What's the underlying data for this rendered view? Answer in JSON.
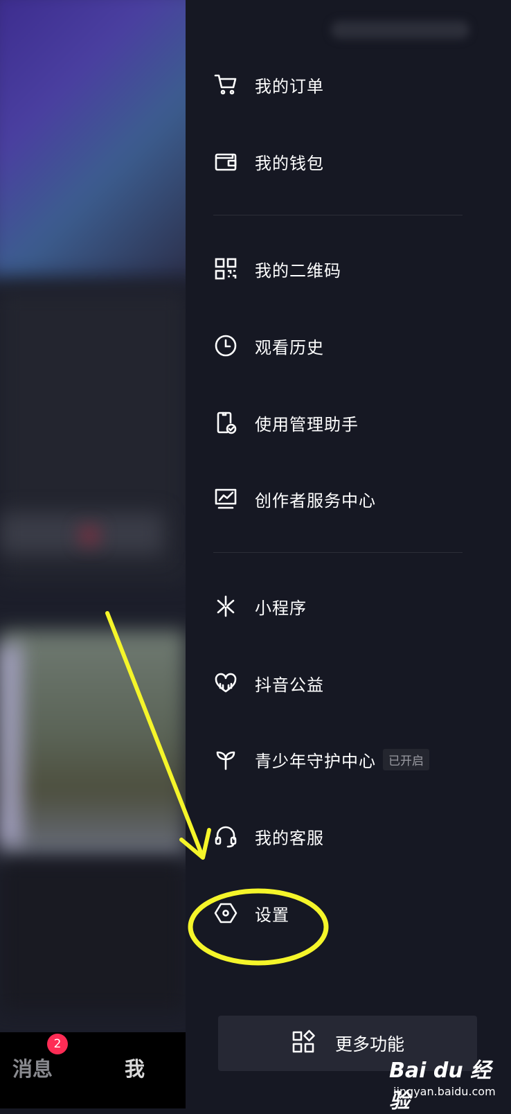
{
  "drawer": {
    "items": [
      {
        "label": "我的订单",
        "icon": "cart-icon"
      },
      {
        "label": "我的钱包",
        "icon": "wallet-icon"
      },
      {
        "label": "我的二维码",
        "icon": "qr-code-icon"
      },
      {
        "label": "观看历史",
        "icon": "clock-icon"
      },
      {
        "label": "使用管理助手",
        "icon": "phone-check-icon"
      },
      {
        "label": "创作者服务中心",
        "icon": "chart-monitor-icon"
      },
      {
        "label": "小程序",
        "icon": "mini-program-icon"
      },
      {
        "label": "抖音公益",
        "icon": "heart-hands-icon"
      },
      {
        "label": "青少年守护中心",
        "icon": "sprout-icon",
        "badge": "已开启"
      },
      {
        "label": "我的客服",
        "icon": "headset-icon"
      },
      {
        "label": "设置",
        "icon": "hexagon-settings-icon"
      }
    ],
    "more_button": {
      "label": "更多功能",
      "icon": "apps-icon"
    }
  },
  "bottom_nav": {
    "messages_label": "消息",
    "messages_badge": "2",
    "me_label": "我"
  },
  "watermark": {
    "brand": "Bai du 经验",
    "url": "jingyan.baidu.com"
  },
  "colors": {
    "drawer_bg": "#161823",
    "annotation": "#f5f52a",
    "badge": "#fe2c55"
  }
}
